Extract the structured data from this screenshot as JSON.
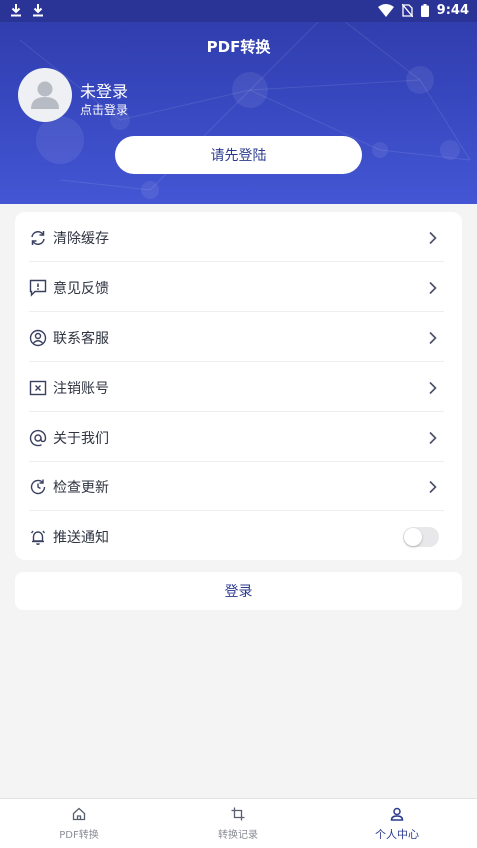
{
  "status_bar": {
    "time": "9:44",
    "left_icons": [
      "download-icon",
      "download-icon"
    ],
    "right_icons": [
      "wifi-icon",
      "no-sim-icon",
      "battery-icon"
    ]
  },
  "header": {
    "title": "PDF转换",
    "avatar_icon": "user-avatar-icon",
    "user_name": "未登录",
    "user_sub": "点击登录",
    "login_button": "请先登陆",
    "accent_color": "#3646bd"
  },
  "menu": {
    "items": [
      {
        "label": "清除缓存",
        "icon": "refresh-icon"
      },
      {
        "label": "意见反馈",
        "icon": "feedback-icon"
      },
      {
        "label": "联系客服",
        "icon": "contact-icon"
      },
      {
        "label": "注销账号",
        "icon": "close-box-icon"
      },
      {
        "label": "关于我们",
        "icon": "at-icon"
      },
      {
        "label": "检查更新",
        "icon": "update-icon"
      },
      {
        "label": "推送通知",
        "icon": "bell-icon",
        "toggle": false
      }
    ]
  },
  "login_button": "登录",
  "bottom_nav": {
    "items": [
      {
        "label": "PDF转换",
        "icon": "home-icon",
        "active": false
      },
      {
        "label": "转换记录",
        "icon": "crop-icon",
        "active": false
      },
      {
        "label": "个人中心",
        "icon": "person-icon",
        "active": true
      }
    ]
  }
}
